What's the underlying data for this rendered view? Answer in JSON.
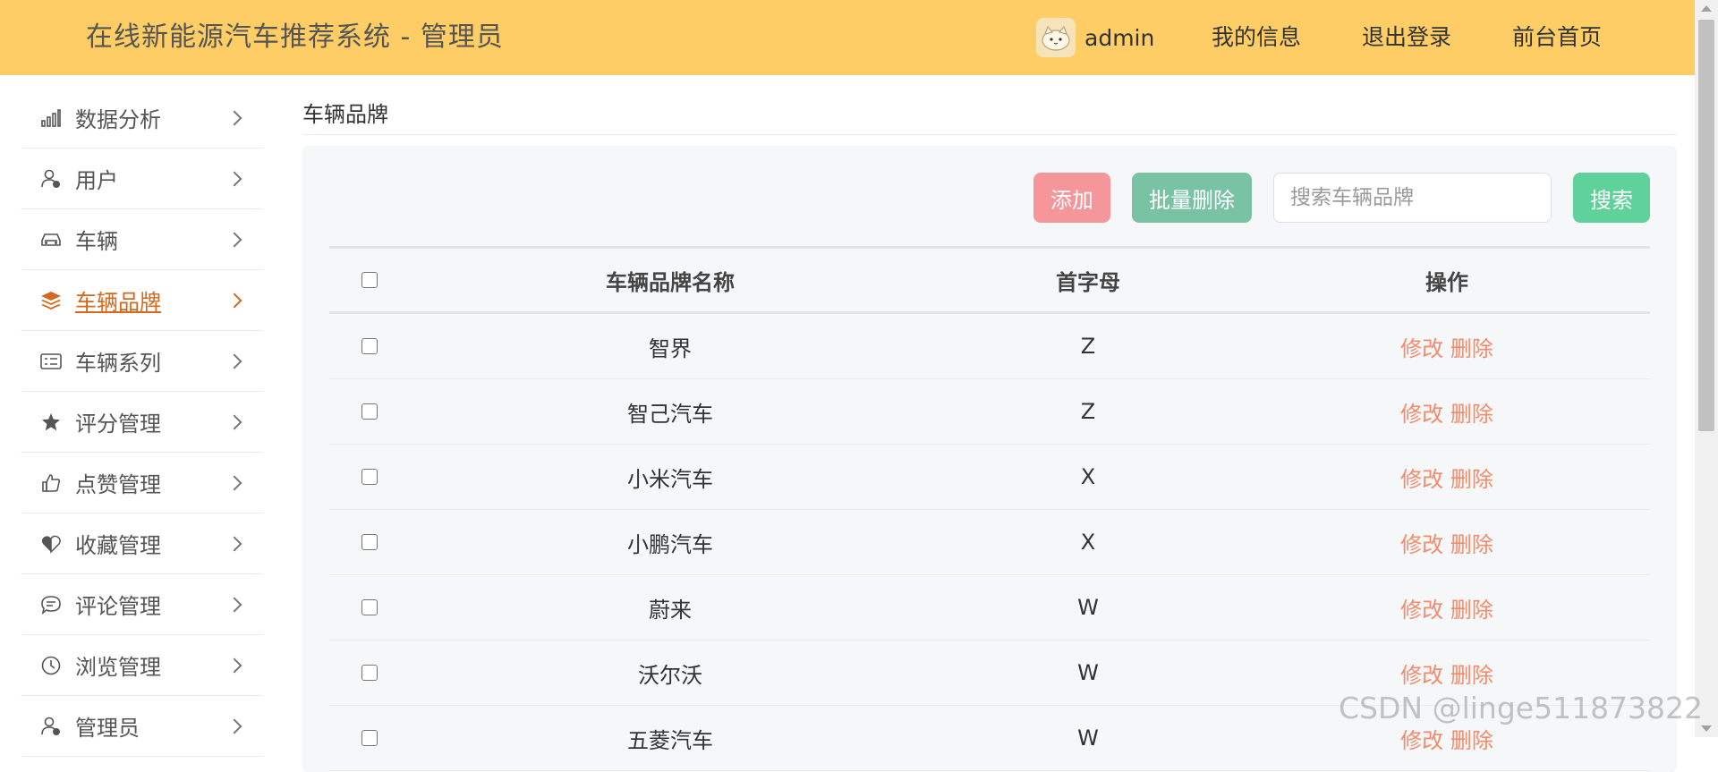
{
  "header": {
    "title": "在线新能源汽车推荐系统 - 管理员",
    "username": "admin",
    "links": [
      "我的信息",
      "退出登录",
      "前台首页"
    ]
  },
  "sidebar": {
    "items": [
      {
        "label": "数据分析",
        "icon": "bar-chart-icon",
        "active": false
      },
      {
        "label": "用户",
        "icon": "user-icon",
        "active": false
      },
      {
        "label": "车辆",
        "icon": "car-icon",
        "active": false
      },
      {
        "label": "车辆品牌",
        "icon": "layers-icon",
        "active": true
      },
      {
        "label": "车辆系列",
        "icon": "id-card-icon",
        "active": false
      },
      {
        "label": "评分管理",
        "icon": "star-icon",
        "active": false
      },
      {
        "label": "点赞管理",
        "icon": "thumb-up-icon",
        "active": false
      },
      {
        "label": "收藏管理",
        "icon": "heart-icon",
        "active": false
      },
      {
        "label": "评论管理",
        "icon": "comment-icon",
        "active": false
      },
      {
        "label": "浏览管理",
        "icon": "clock-icon",
        "active": false
      },
      {
        "label": "管理员",
        "icon": "admin-icon",
        "active": false
      }
    ]
  },
  "main": {
    "breadcrumb": "车辆品牌",
    "toolbar": {
      "add_label": "添加",
      "batch_delete_label": "批量删除",
      "search_placeholder": "搜索车辆品牌",
      "search_label": "搜索"
    },
    "table": {
      "columns": [
        "车辆品牌名称",
        "首字母",
        "操作"
      ],
      "rows": [
        {
          "name": "智界",
          "letter": "Z"
        },
        {
          "name": "智己汽车",
          "letter": "Z"
        },
        {
          "name": "小米汽车",
          "letter": "X"
        },
        {
          "name": "小鹏汽车",
          "letter": "X"
        },
        {
          "name": "蔚来",
          "letter": "W"
        },
        {
          "name": "沃尔沃",
          "letter": "W"
        },
        {
          "name": "五菱汽车",
          "letter": "W"
        }
      ],
      "edit_label": "修改",
      "delete_label": "删除"
    }
  },
  "watermark": "CSDN @linge511873822",
  "colors": {
    "header_bg": "#fecd65",
    "active": "#d2691e",
    "add_btn": "#f5979a",
    "batch_btn": "#7ac2a4",
    "search_btn": "#5fd19a",
    "op_link": "#f28b6c"
  }
}
